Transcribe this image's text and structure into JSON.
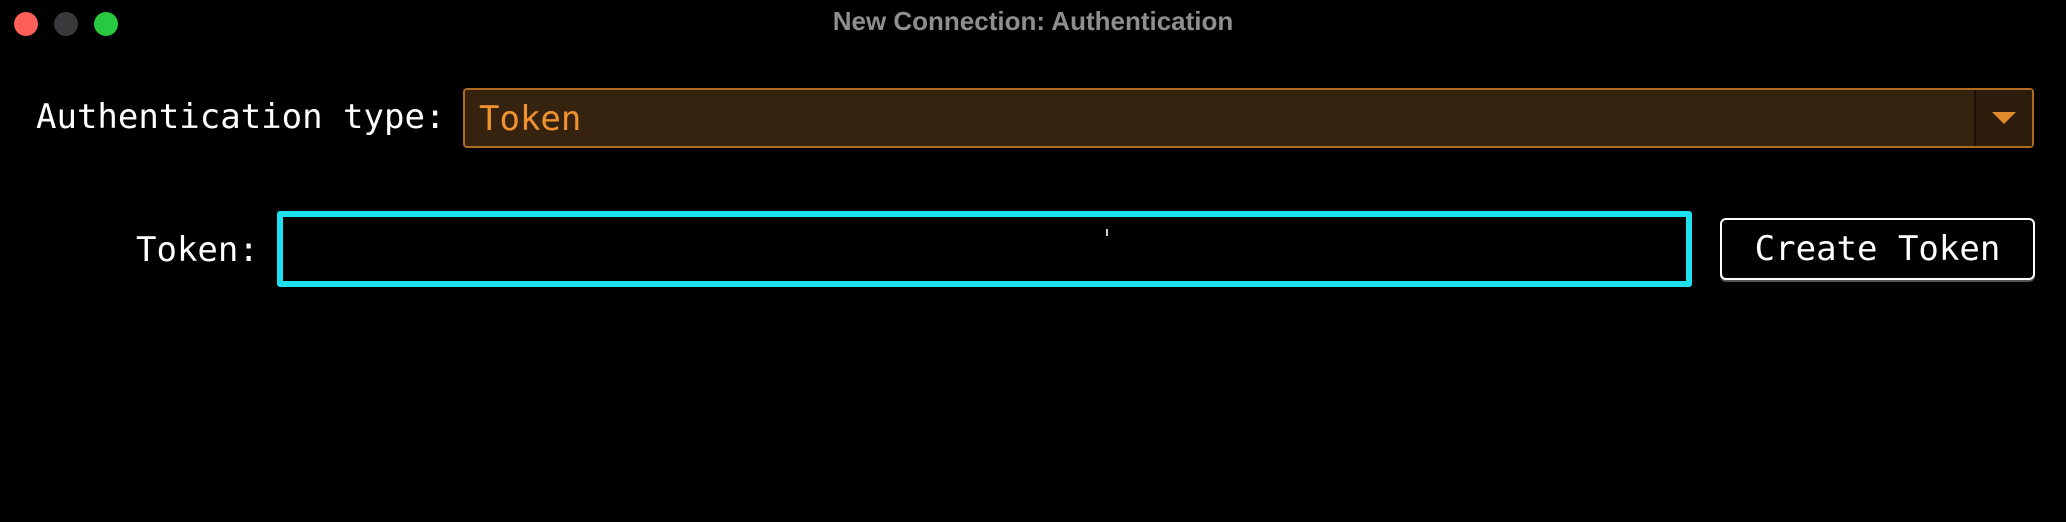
{
  "window": {
    "title": "New Connection: Authentication"
  },
  "auth": {
    "label": "Authentication type:",
    "selected": "Token"
  },
  "token": {
    "label": "Token:",
    "value": "",
    "placeholder": ""
  },
  "buttons": {
    "create_token": "Create Token"
  },
  "colors": {
    "background": "#000000",
    "select_bg": "#35220f",
    "select_border": "#b06a22",
    "select_text": "#f0922f",
    "focus_ring": "#1ee0f0",
    "traffic_close": "#fe5f57",
    "traffic_minimize": "#3a3a3c",
    "traffic_zoom": "#28c840"
  },
  "icons": {
    "dropdown": "chevron-down-icon"
  }
}
